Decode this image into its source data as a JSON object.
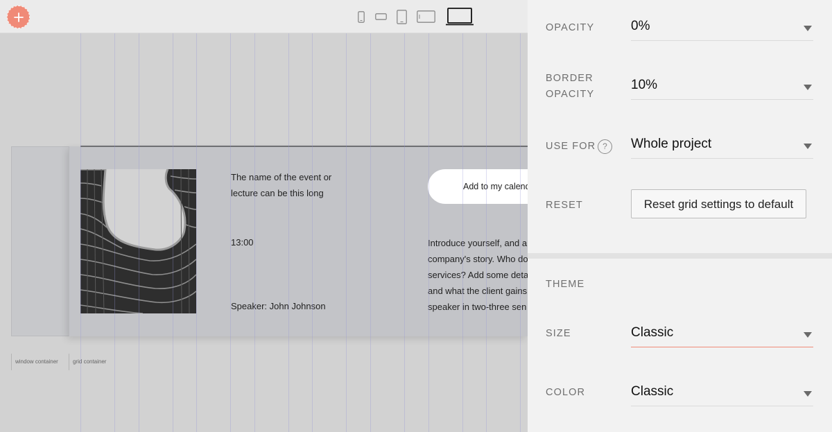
{
  "toolbar": {
    "add_icon": "plus-icon",
    "add_button_color": "#f08a77",
    "devices": [
      {
        "name": "phone-portrait",
        "icon": "phone-portrait-icon"
      },
      {
        "name": "phone-landscape",
        "icon": "phone-landscape-icon"
      },
      {
        "name": "tablet-portrait",
        "icon": "tablet-portrait-icon"
      },
      {
        "name": "tablet-landscape",
        "icon": "tablet-landscape-icon"
      },
      {
        "name": "laptop",
        "icon": "laptop-icon",
        "selected": true
      }
    ]
  },
  "canvas": {
    "event": {
      "title": "The name of the event or lecture can be this long",
      "time": "13:00",
      "speaker": "Speaker: John Johnson",
      "calendar_button": "Add to my calendar",
      "description": "Introduce yourself, and a company's story. Who do services? Add some deta and what the client gains speaker in two-three sen"
    },
    "labels": {
      "window_container": "window container",
      "grid_container": "grid container"
    }
  },
  "settings": {
    "opacity": {
      "label": "OPACITY",
      "value": "0%"
    },
    "border_opacity": {
      "label": "BORDER OPACITY",
      "value": "10%"
    },
    "use_for": {
      "label": "USE FOR",
      "help_icon": "question-icon",
      "value": "Whole project"
    },
    "reset": {
      "label": "RESET",
      "button": "Reset grid settings to default"
    },
    "theme": {
      "label": "THEME"
    },
    "size": {
      "label": "SIZE",
      "value": "Classic"
    },
    "color": {
      "label": "COLOR",
      "value": "Classic"
    },
    "accent_color": "#f08a77"
  }
}
